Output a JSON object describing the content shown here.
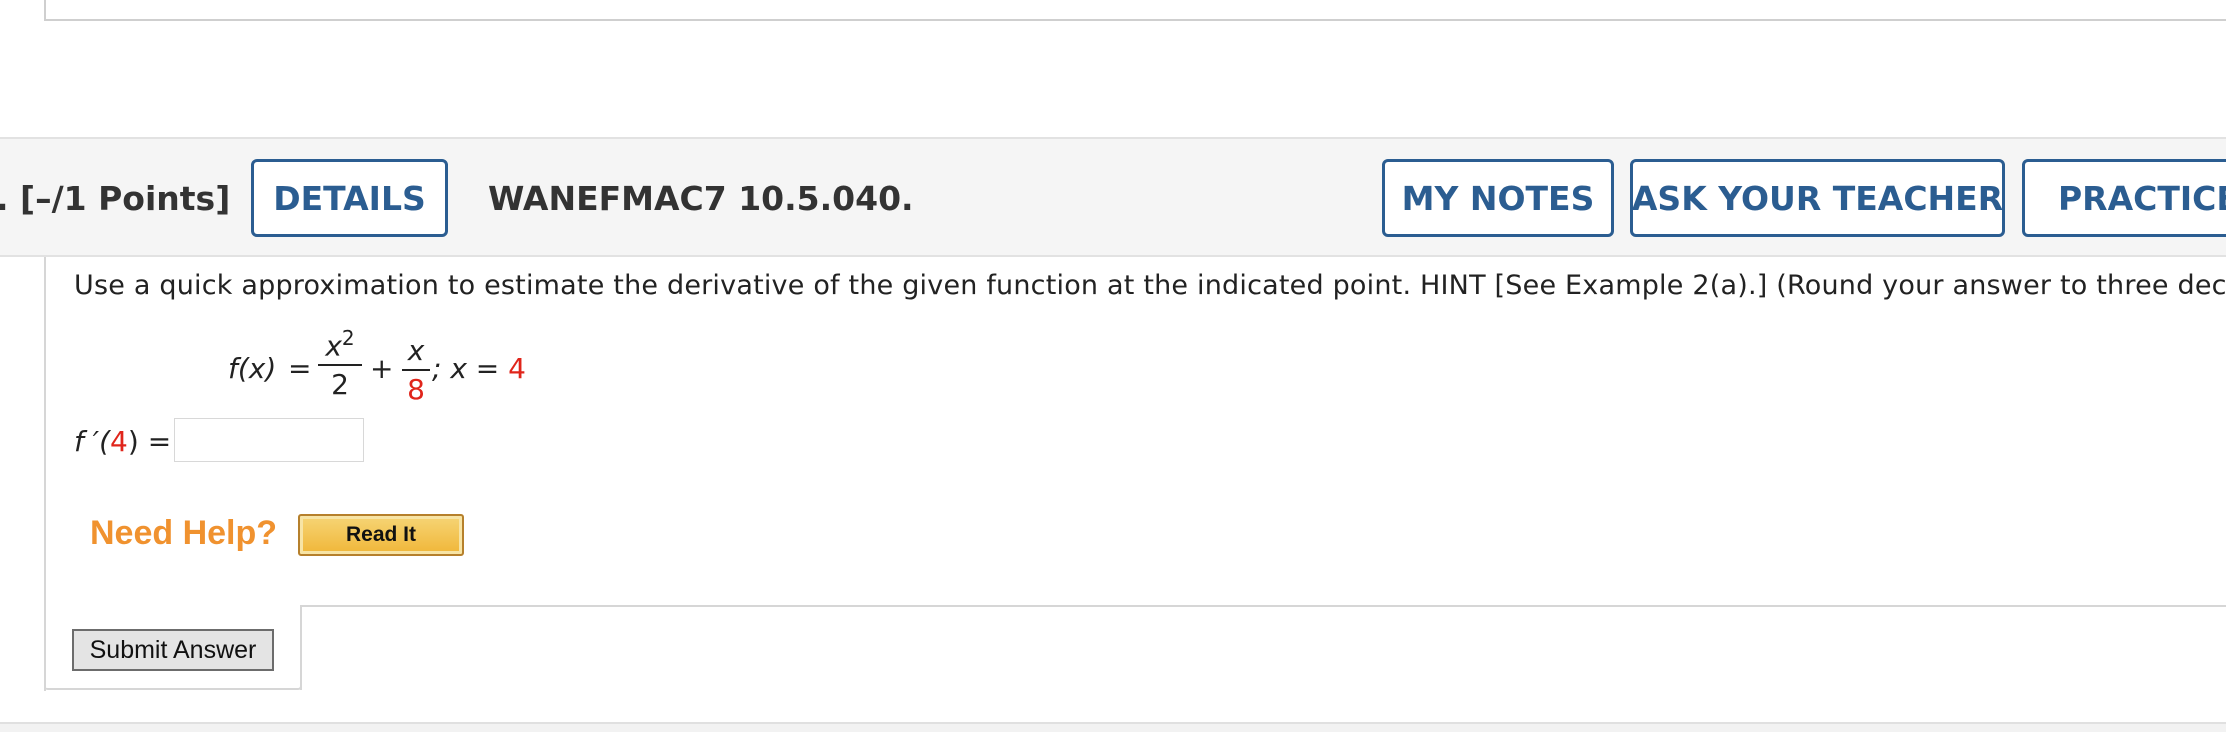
{
  "header": {
    "points": ". [–/1 Points]",
    "details_label": "DETAILS",
    "question_id": "WANEFMAC7 10.5.040.",
    "my_notes_label": "MY NOTES",
    "ask_teacher_label": "ASK YOUR TEACHER",
    "practice_label": "PRACTICE A"
  },
  "question": {
    "instructions": "Use a quick approximation to estimate the derivative of the given function at the indicated point. HINT [See Example 2(a).] (Round your answer to three decimal pl",
    "function_lhs": "f(x)",
    "equals": "=",
    "term1_numerator": "x",
    "term1_exponent": "2",
    "term1_denominator": "2",
    "plus": "+",
    "term2_numerator": "x",
    "term2_denominator": "8",
    "point_label": "; x = ",
    "point_value": "4",
    "derivative_prefix": "f ′(",
    "derivative_point": "4",
    "derivative_suffix": ") =",
    "answer_value": ""
  },
  "help": {
    "need_help_label": "Need Help?",
    "read_it_label": "Read It"
  },
  "actions": {
    "submit_label": "Submit Answer"
  },
  "colors": {
    "accent_blue": "#2b5d91",
    "highlight_red": "#e0251b",
    "help_orange": "#f0922f"
  }
}
